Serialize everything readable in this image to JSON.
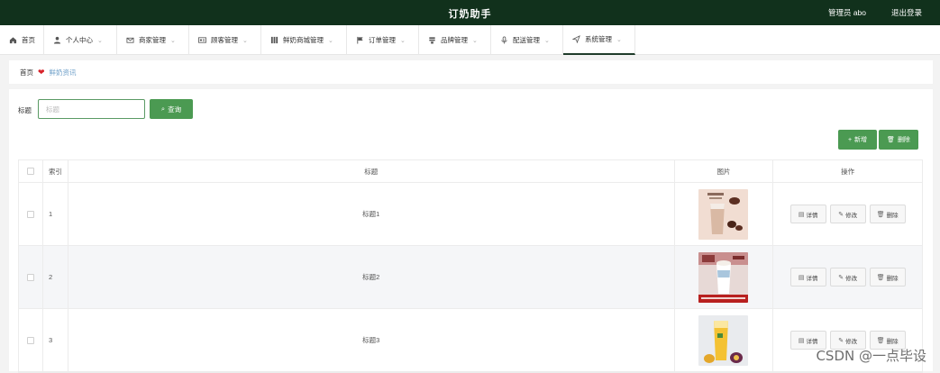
{
  "header": {
    "title": "订奶助手",
    "user": "管理员 abo",
    "logout": "退出登录"
  },
  "nav": [
    {
      "label": "首页",
      "icon": "home-icon",
      "chevron": false
    },
    {
      "label": "个人中心",
      "icon": "user-icon",
      "chevron": true
    },
    {
      "label": "商家管理",
      "icon": "mail-icon",
      "chevron": true
    },
    {
      "label": "顾客管理",
      "icon": "id-card-icon",
      "chevron": true
    },
    {
      "label": "鲜奶商城管理",
      "icon": "columns-icon",
      "chevron": true
    },
    {
      "label": "订单管理",
      "icon": "flag-icon",
      "chevron": true
    },
    {
      "label": "品牌管理",
      "icon": "stack-icon",
      "chevron": true
    },
    {
      "label": "配送管理",
      "icon": "mic-icon",
      "chevron": true
    },
    {
      "label": "系统管理",
      "icon": "send-icon",
      "chevron": true,
      "active": true
    }
  ],
  "breadcrumb": {
    "home": "首页",
    "current": "鲜奶资讯"
  },
  "search": {
    "label": "标题",
    "placeholder": "标题",
    "button": "查询"
  },
  "actions": {
    "add": "新增",
    "delete": "删除"
  },
  "table": {
    "columns": [
      "索引",
      "标题",
      "图片",
      "操作"
    ],
    "rows": [
      {
        "index": "1",
        "title": "标题1"
      },
      {
        "index": "2",
        "title": "标题2"
      },
      {
        "index": "3",
        "title": "标题3"
      }
    ],
    "row_actions": {
      "detail": "详情",
      "edit": "修改",
      "delete": "删除"
    }
  },
  "watermark": "CSDN @一点毕设",
  "colors": {
    "topbar": "#11311c",
    "primary": "#4b9a52",
    "heart": "#d8232a"
  }
}
